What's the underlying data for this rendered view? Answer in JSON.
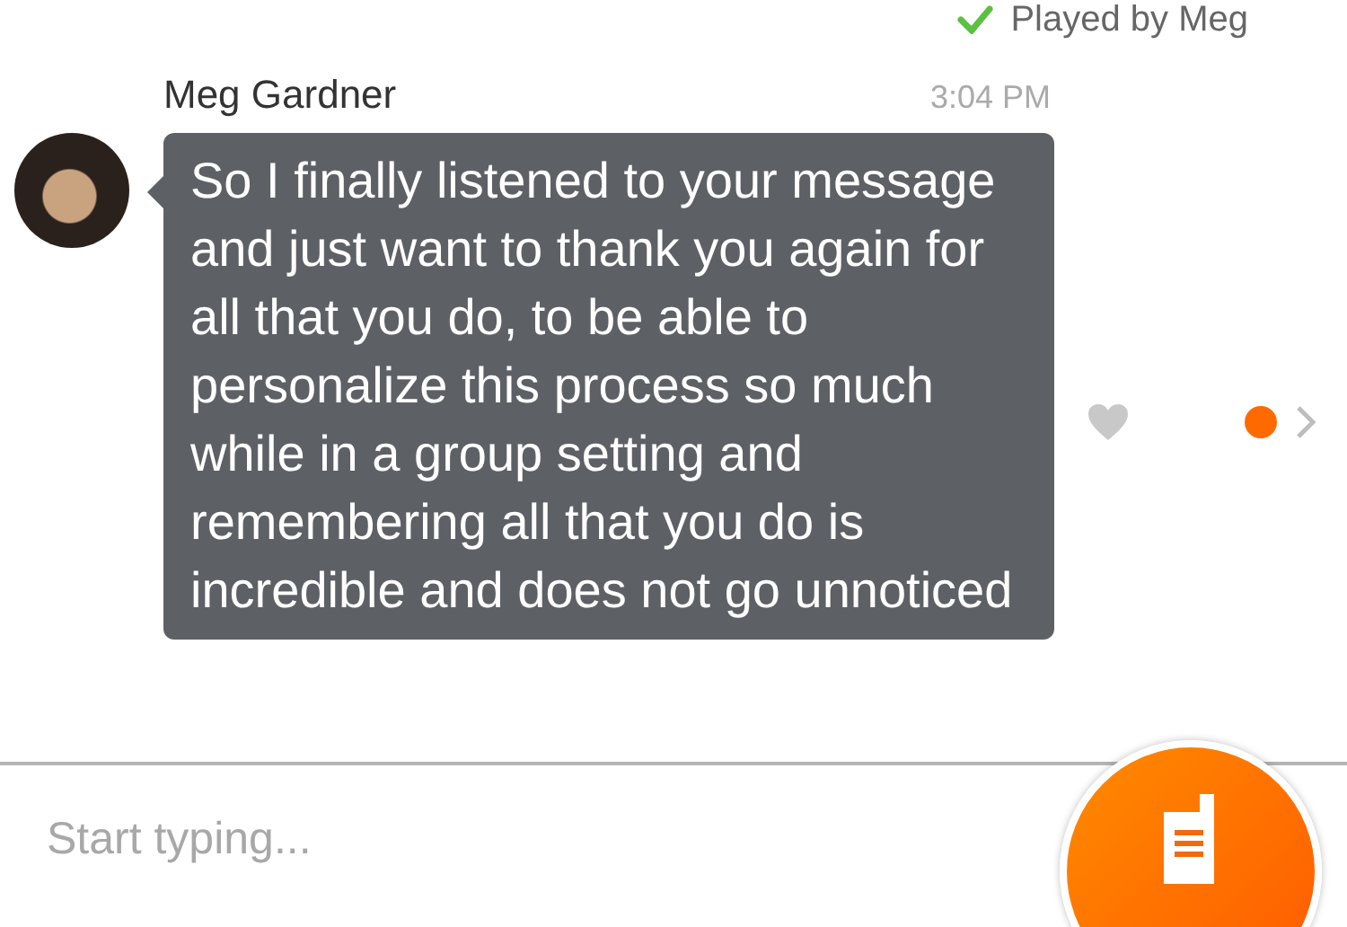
{
  "status": {
    "played": true,
    "text": "Played by Meg"
  },
  "message": {
    "sender": "Meg Gardner",
    "time": "3:04 PM",
    "text": "So I finally listened to your message and just want to thank you again for all that you do, to be able to personalize this process so much while in a group setting and remembering all that you do is incredible and does not go unnoticed",
    "liked": false,
    "unread": true
  },
  "composer": {
    "placeholder": "Start typing..."
  }
}
